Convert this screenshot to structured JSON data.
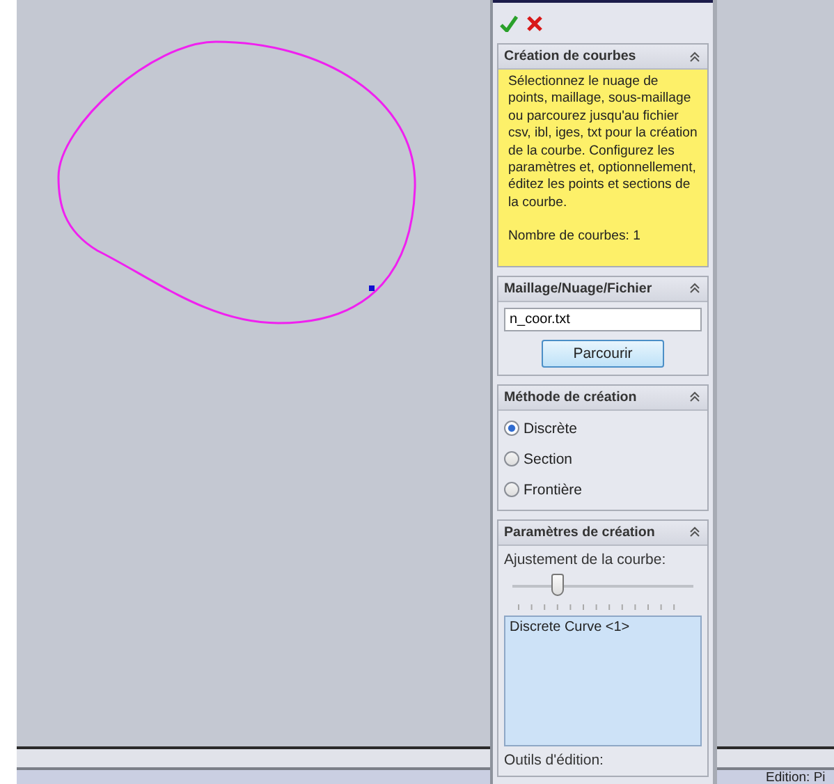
{
  "panel": {
    "actions": [
      {
        "kind": "ok"
      },
      {
        "kind": "cancel"
      }
    ],
    "sections": [
      {
        "kind": "message",
        "title": "Création de courbes",
        "expanded": true,
        "paragraphs": [
          "Sélectionnez le nuage de points, maillage, sous-maillage ou parcourez jusqu'au fichier csv, ibl, iges, txt pour la création de la courbe. Configurez les paramètres et, optionnellement, éditez les points et sections de la courbe.",
          "Nombre de courbes: 1"
        ]
      },
      {
        "kind": "file",
        "title": "Maillage/Nuage/Fichier",
        "expanded": true,
        "value": "n_coor.txt",
        "button": "Parcourir"
      },
      {
        "kind": "radios",
        "title": "Méthode de création",
        "expanded": true,
        "options": [
          {
            "label": "Discrète",
            "selected": true
          },
          {
            "label": "Section",
            "selected": false
          },
          {
            "label": "Frontière",
            "selected": false
          }
        ]
      },
      {
        "kind": "params",
        "title": "Paramètres de création",
        "expanded": true,
        "slider_label": "Ajustement de la courbe:",
        "level": 0.25,
        "list": [
          "Discrete Curve <1>"
        ],
        "footer_label": "Outils d'édition:"
      }
    ]
  },
  "status_bar": {
    "text": "Edition: Pi"
  }
}
